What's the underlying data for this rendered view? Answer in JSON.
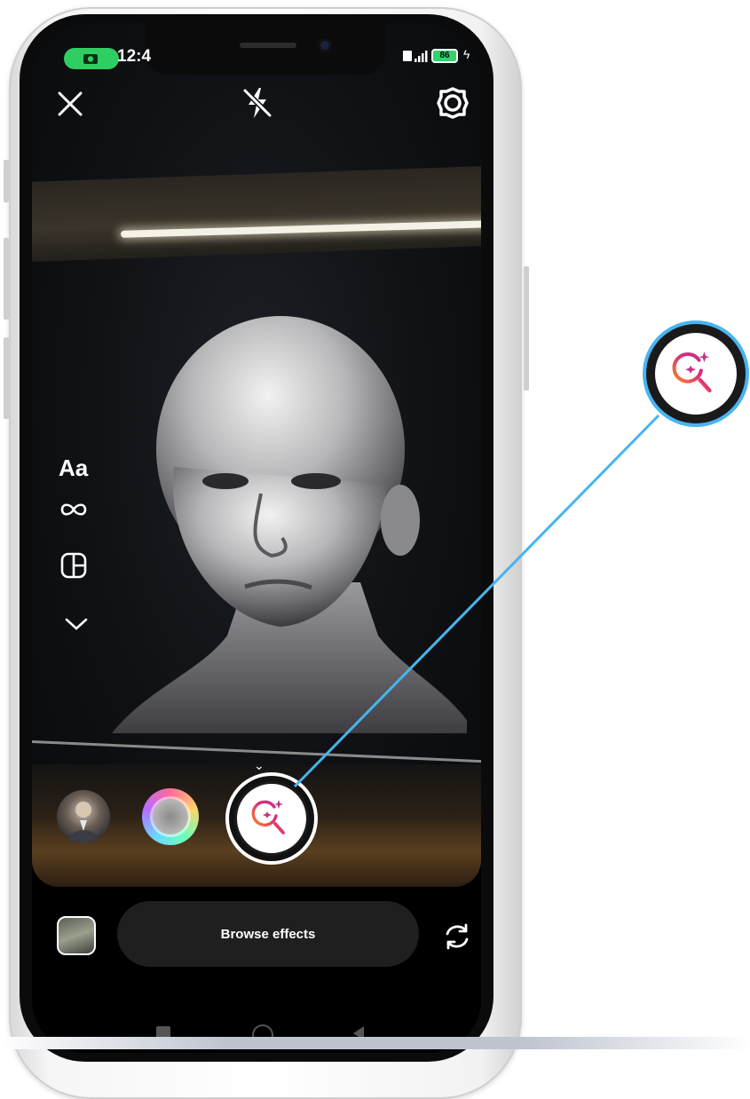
{
  "status_bar": {
    "time": "12:4",
    "battery": "86",
    "network_icon": "signal-icon",
    "camera_indicator_icon": "camera-indicator-icon"
  },
  "top_controls": {
    "close_icon": "close-icon",
    "flash_icon": "flash-off-icon",
    "settings_icon": "settings-gear-icon"
  },
  "side_tools": {
    "text_tool": "Aa",
    "boomerang_icon": "infinity-icon",
    "layout_icon": "layout-icon",
    "more_icon": "chevron-down-icon"
  },
  "effects_tray": {
    "items": [
      "avatar-effect",
      "ring-effect",
      "search-effects-shutter"
    ],
    "selected": "search-effects-shutter"
  },
  "bottom": {
    "browse_effects_label": "Browse effects",
    "gallery_icon": "gallery-thumbnail",
    "flip_camera_icon": "flip-camera-icon"
  },
  "callout": {
    "icon": "sparkle-search-icon",
    "accent_color": "#48b4f0"
  },
  "colors": {
    "status_green": "#2fce62",
    "callout_blue": "#48b4f0",
    "icon_gradient_start": "#f58529",
    "icon_gradient_end": "#c13584"
  }
}
